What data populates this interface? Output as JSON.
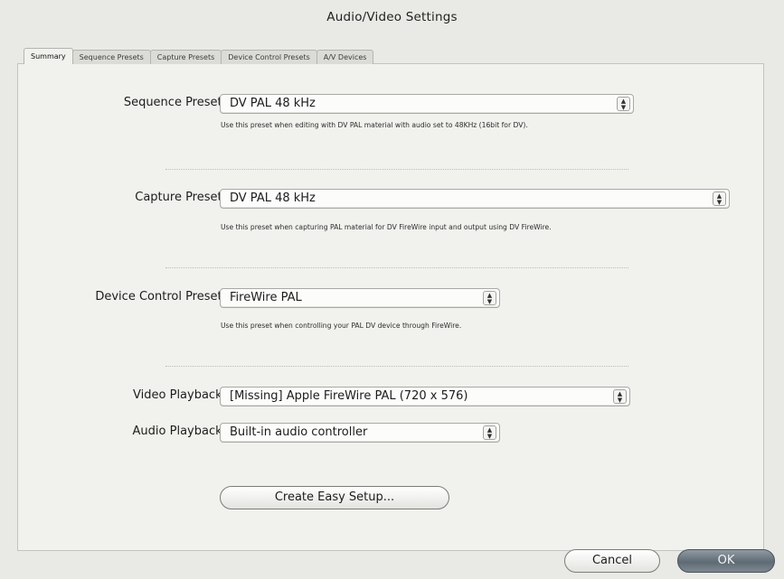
{
  "window": {
    "title": "Audio/Video Settings"
  },
  "tabs": [
    {
      "label": "Summary",
      "active": true
    },
    {
      "label": "Sequence Presets",
      "active": false
    },
    {
      "label": "Capture Presets",
      "active": false
    },
    {
      "label": "Device Control Presets",
      "active": false
    },
    {
      "label": "A/V Devices",
      "active": false
    }
  ],
  "sequence_preset": {
    "label": "Sequence Preset:",
    "value": "DV PAL 48 kHz",
    "hint": "Use this preset when editing with DV PAL material with audio set to 48KHz (16bit for DV)."
  },
  "capture_preset": {
    "label": "Capture Preset:",
    "value": "DV PAL 48 kHz",
    "hint": "Use this preset when capturing PAL material for DV FireWire input and output using DV FireWire."
  },
  "device_control_preset": {
    "label": "Device Control Preset:",
    "value": "FireWire PAL",
    "hint": "Use this preset when controlling your PAL DV device through FireWire."
  },
  "video_playback": {
    "label": "Video Playback:",
    "value": "[Missing] Apple FireWire PAL (720 x 576)"
  },
  "audio_playback": {
    "label": "Audio Playback:",
    "value": "Built-in audio controller"
  },
  "buttons": {
    "create_easy_setup": "Create Easy Setup...",
    "cancel": "Cancel",
    "ok": "OK"
  },
  "icons": {
    "popup": "up-down-chevron-icon"
  },
  "colors": {
    "background": "#e9e9e6",
    "panel": "#f1f1ee",
    "default_button": "#6b7780"
  }
}
